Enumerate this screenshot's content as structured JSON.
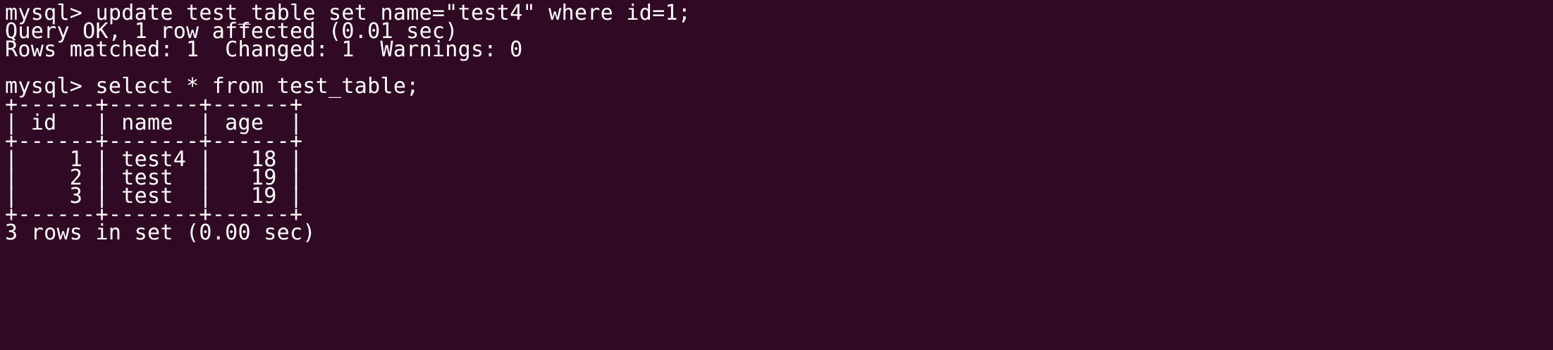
{
  "terminal": {
    "background": "#300a24",
    "foreground": "#ffffff",
    "lines": [
      "mysql> update test_table set name=\"test4\" where id=1;",
      "Query OK, 1 row affected (0.01 sec)",
      "Rows matched: 1  Changed: 1  Warnings: 0",
      "",
      "mysql> select * from test_table;",
      "+------+-------+------+",
      "| id   | name  | age  |",
      "+------+-------+------+",
      "|    1 | test4 |   18 |",
      "|    2 | test  |   19 |",
      "|    3 | test  |   19 |",
      "+------+-------+------+",
      "3 rows in set (0.00 sec)"
    ]
  }
}
